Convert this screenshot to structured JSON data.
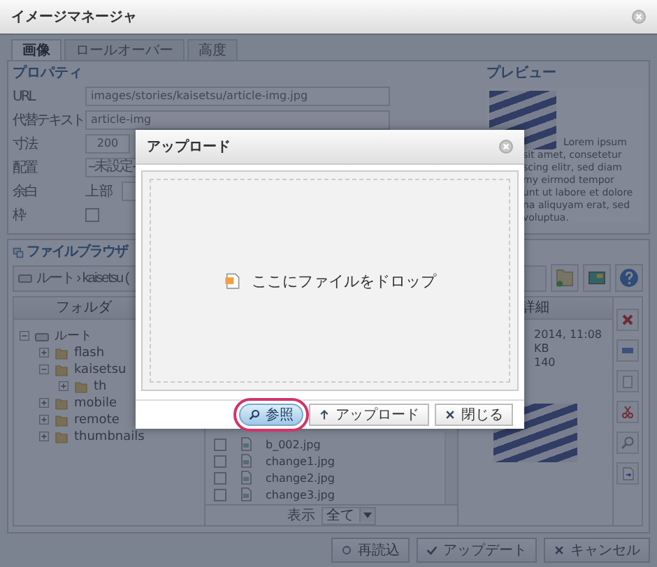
{
  "window": {
    "title": "イメージマネージャ"
  },
  "tabs": [
    {
      "label": "画像",
      "selected": true
    },
    {
      "label": "ロールオーバー",
      "selected": false
    },
    {
      "label": "高度",
      "selected": false
    }
  ],
  "properties": {
    "heading": "プロパティ",
    "fields": [
      {
        "kind": "text",
        "label": "URL",
        "value": "images/stories/kaisetsu/article-img.jpg"
      },
      {
        "kind": "text",
        "label": "代替テキスト",
        "value": "article-img"
      },
      {
        "kind": "short",
        "label": "寸法",
        "value": "200"
      },
      {
        "kind": "select",
        "label": "配置",
        "value": "--未設定-"
      },
      {
        "kind": "sub",
        "label": "余白",
        "value": "上部"
      },
      {
        "kind": "checkbox",
        "label": "枠",
        "checked": false
      }
    ]
  },
  "preview": {
    "heading": "プレビュー",
    "lines": [
      "Lorem ipsum",
      "sit amet, consetetur",
      "scing elitr, sed diam",
      "my eirmod tempor",
      "unt ut labore et dolore",
      "na aliquyam erat, sed",
      "voluptua."
    ]
  },
  "file_browser": {
    "heading": "ファイルブラウザ",
    "path": "ルート › kaisetsu (",
    "columns": [
      "フォルダ",
      "詳細"
    ],
    "tree": [
      {
        "label": "ルート",
        "kind": "root",
        "expanded": true,
        "children": [
          {
            "label": "flash",
            "kind": "folder",
            "expanded": false
          },
          {
            "label": "kaisetsu",
            "kind": "folder",
            "expanded": true,
            "children": [
              {
                "label": "th",
                "kind": "folder",
                "expanded": false
              }
            ]
          },
          {
            "label": "mobile",
            "kind": "folder",
            "expanded": false
          },
          {
            "label": "remote",
            "kind": "folder",
            "expanded": false
          },
          {
            "label": "thumbnails",
            "kind": "folder",
            "expanded": false
          }
        ]
      }
    ],
    "files": [
      {
        "name": "b_002.jpg",
        "checked": false
      },
      {
        "name": "change1.jpg",
        "checked": false
      },
      {
        "name": "change2.jpg",
        "checked": false
      },
      {
        "name": "change3.jpg",
        "checked": false
      }
    ],
    "filter_label": "表示",
    "filter_value": "全て",
    "details": [
      "2014, 11:08",
      "KB",
      "140"
    ]
  },
  "actions": [
    {
      "label": "再読込",
      "kind": "reload"
    },
    {
      "label": "アップデート",
      "kind": "check"
    },
    {
      "label": "キャンセル",
      "kind": "cross"
    }
  ],
  "upload_dialog": {
    "title": "アップロード",
    "drop_text": "ここにファイルをドロップ",
    "buttons": [
      {
        "label": "参照",
        "kind": "search",
        "highlighted": true
      },
      {
        "label": "アップロード",
        "kind": "up",
        "highlighted": false
      },
      {
        "label": "閉じる",
        "kind": "cross",
        "highlighted": false
      }
    ]
  }
}
